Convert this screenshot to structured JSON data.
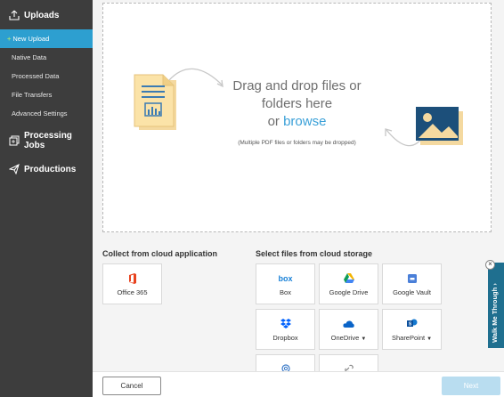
{
  "sidebar": {
    "uploads": "Uploads",
    "items": [
      "New Upload",
      "Native Data",
      "Processed Data",
      "File Transfers",
      "Advanced Settings"
    ],
    "processing_jobs": "Processing Jobs",
    "productions": "Productions"
  },
  "dropzone": {
    "line1": "Drag and drop files or",
    "line2": "folders here",
    "or": "or",
    "browse": "browse",
    "hint": "(Multiple PDF files or folders may be dropped)"
  },
  "cloud_app": {
    "title": "Collect from cloud application",
    "tiles": [
      "Office 365"
    ]
  },
  "cloud_storage": {
    "title": "Select files from cloud storage",
    "tiles": [
      "Box",
      "Google Drive",
      "Google Vault",
      "Dropbox",
      "OneDrive",
      "SharePoint"
    ],
    "box_logo": "box"
  },
  "footer": {
    "cancel": "Cancel",
    "next": "Next"
  },
  "walkme": {
    "label": "Walk Me Through",
    "close": "×",
    "chevron": "›"
  },
  "colors": {
    "sidebar": "#3d3d3d",
    "active": "#2d9fd0",
    "accent": "#3aa0d8",
    "next_disabled": "#b9ddf0"
  }
}
